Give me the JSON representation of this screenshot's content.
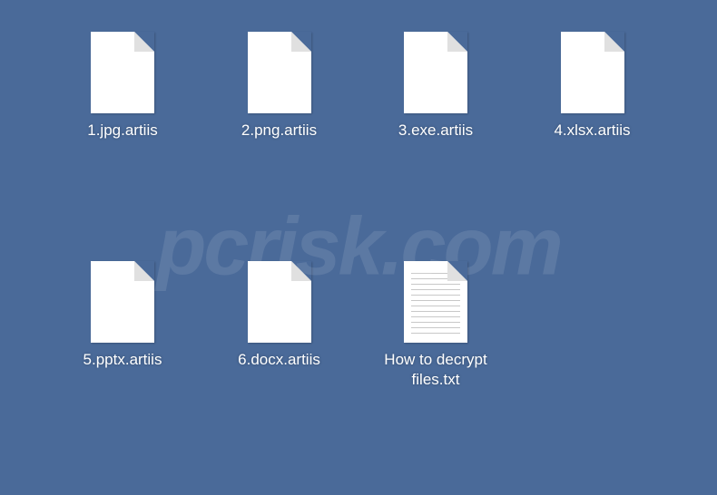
{
  "files": [
    {
      "name": "1.jpg.artiis",
      "type": "blank"
    },
    {
      "name": "2.png.artiis",
      "type": "blank"
    },
    {
      "name": "3.exe.artiis",
      "type": "blank"
    },
    {
      "name": "4.xlsx.artiis",
      "type": "blank"
    },
    {
      "name": "5.pptx.artiis",
      "type": "blank"
    },
    {
      "name": "6.docx.artiis",
      "type": "blank"
    },
    {
      "name": "How to decrypt files.txt",
      "type": "text"
    }
  ],
  "watermark": "pcrisk.com"
}
